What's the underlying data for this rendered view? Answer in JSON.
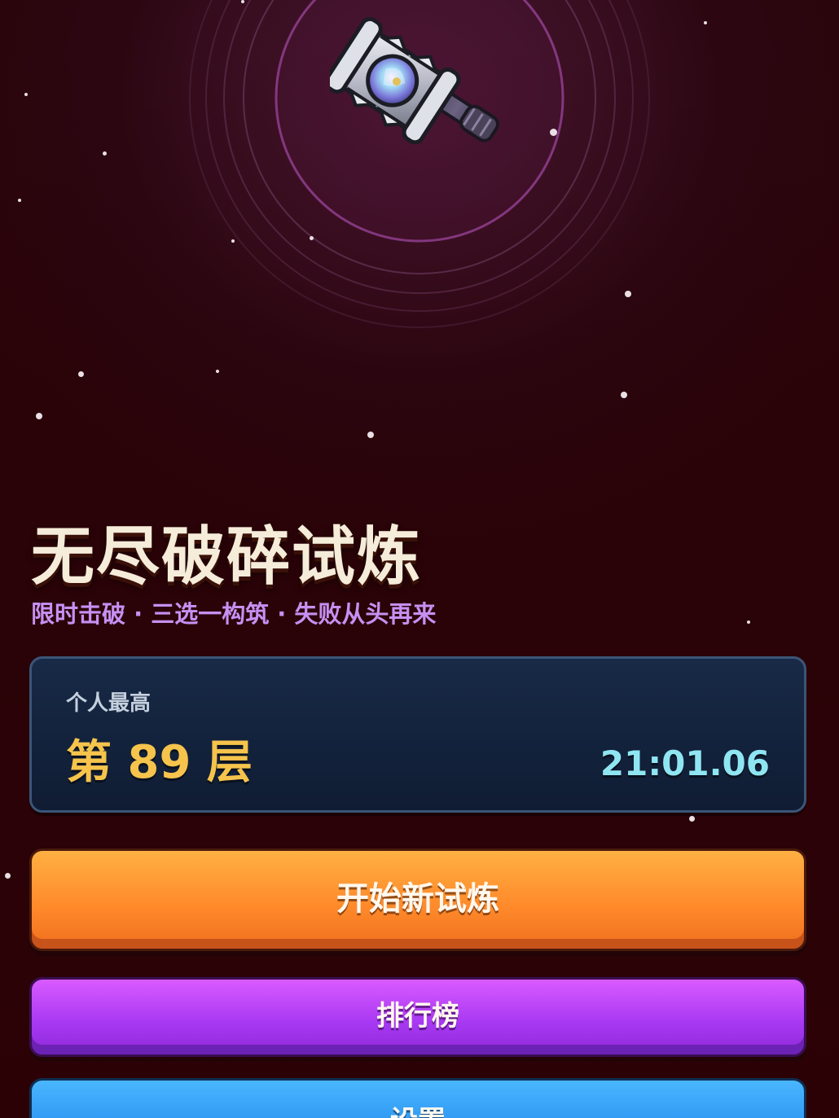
{
  "game": {
    "title": "无尽破碎试炼",
    "subtitle": "限时击破 · 三选一构筑 · 失败从头再来",
    "emblem": "hammer-icon"
  },
  "best_record": {
    "label": "个人最高",
    "floor_text": "第 89 层",
    "time": "21:01.06"
  },
  "buttons": {
    "start": "开始新试炼",
    "leaderboard": "排行榜",
    "settings": "设置"
  },
  "colors": {
    "background": "#2a0408",
    "title": "#f5ecd9",
    "subtitle": "#c690f2",
    "floor": "#f6c44c",
    "time": "#8fe6f2",
    "start_button": "#ff8b2b",
    "leaderboard_button": "#a637f2",
    "settings_button": "#2d97f2"
  }
}
